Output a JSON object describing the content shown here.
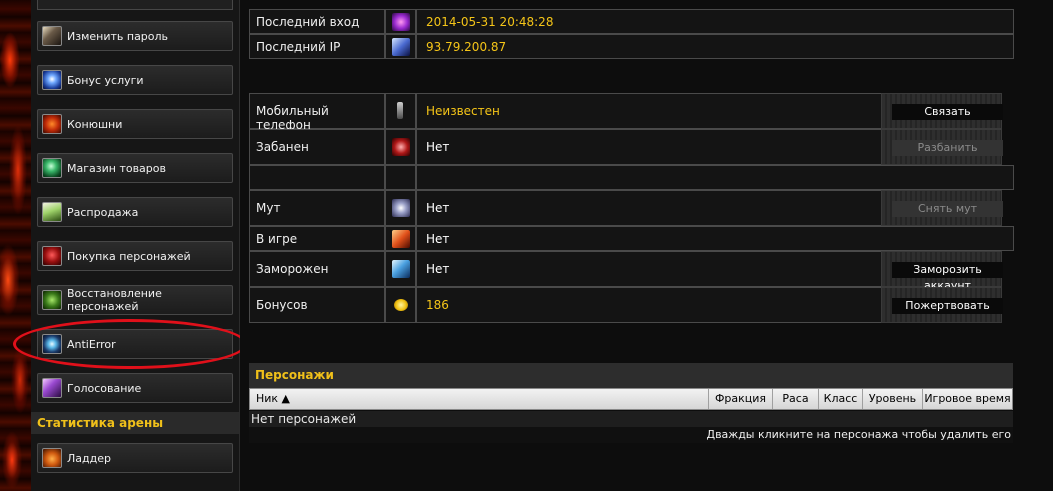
{
  "sidebar": {
    "items": [
      {
        "label": "Изменить пароль",
        "icon": "change-password-icon"
      },
      {
        "label": "Бонус услуги",
        "icon": "bonus-services-icon"
      },
      {
        "label": "Конюшни",
        "icon": "stables-icon"
      },
      {
        "label": "Магазин товаров",
        "icon": "shop-icon"
      },
      {
        "label": "Распродажа",
        "icon": "sale-icon"
      },
      {
        "label": "Покупка персонажей",
        "icon": "buy-characters-icon"
      },
      {
        "label": "Восстановление персонажей",
        "icon": "restore-characters-icon"
      },
      {
        "label": "AntiError",
        "icon": "antierror-icon"
      },
      {
        "label": "Голосование",
        "icon": "vote-icon"
      }
    ],
    "arena_section": {
      "title": "Статистика арены",
      "items": [
        {
          "label": "Ладдер",
          "icon": "ladder-icon"
        }
      ]
    },
    "highlight_color": "#e0101a"
  },
  "account": {
    "last_login": {
      "label": "Последний вход",
      "value": "2014-05-31 20:48:28"
    },
    "last_ip": {
      "label": "Последний IP",
      "value": "93.79.200.87"
    },
    "phone": {
      "label": "Мобильный телефон",
      "value": "Неизвестен",
      "action": "Связать"
    },
    "banned": {
      "label": "Забанен",
      "value": "Нет",
      "action": "Разбанить",
      "action_disabled": true
    },
    "mute": {
      "label": "Мут",
      "value": "Нет",
      "action": "Снять мут",
      "action_disabled": true
    },
    "in_game": {
      "label": "В игре",
      "value": "Нет"
    },
    "frozen": {
      "label": "Заморожен",
      "value": "Нет",
      "action": "Заморозить аккаунт"
    },
    "bonuses": {
      "label": "Бонусов",
      "value": "186",
      "action": "Пожертвовать"
    }
  },
  "characters": {
    "title": "Персонажи",
    "columns": [
      "Ник ▲",
      "Фракция",
      "Раса",
      "Класс",
      "Уровень",
      "Игровое время"
    ],
    "empty_text": "Нет персонажей",
    "footer_hint": "Дважды кликните на персонажа чтобы удалить его"
  },
  "colors": {
    "accent_yellow": "#f5c518",
    "background": "#0d0d0d"
  }
}
